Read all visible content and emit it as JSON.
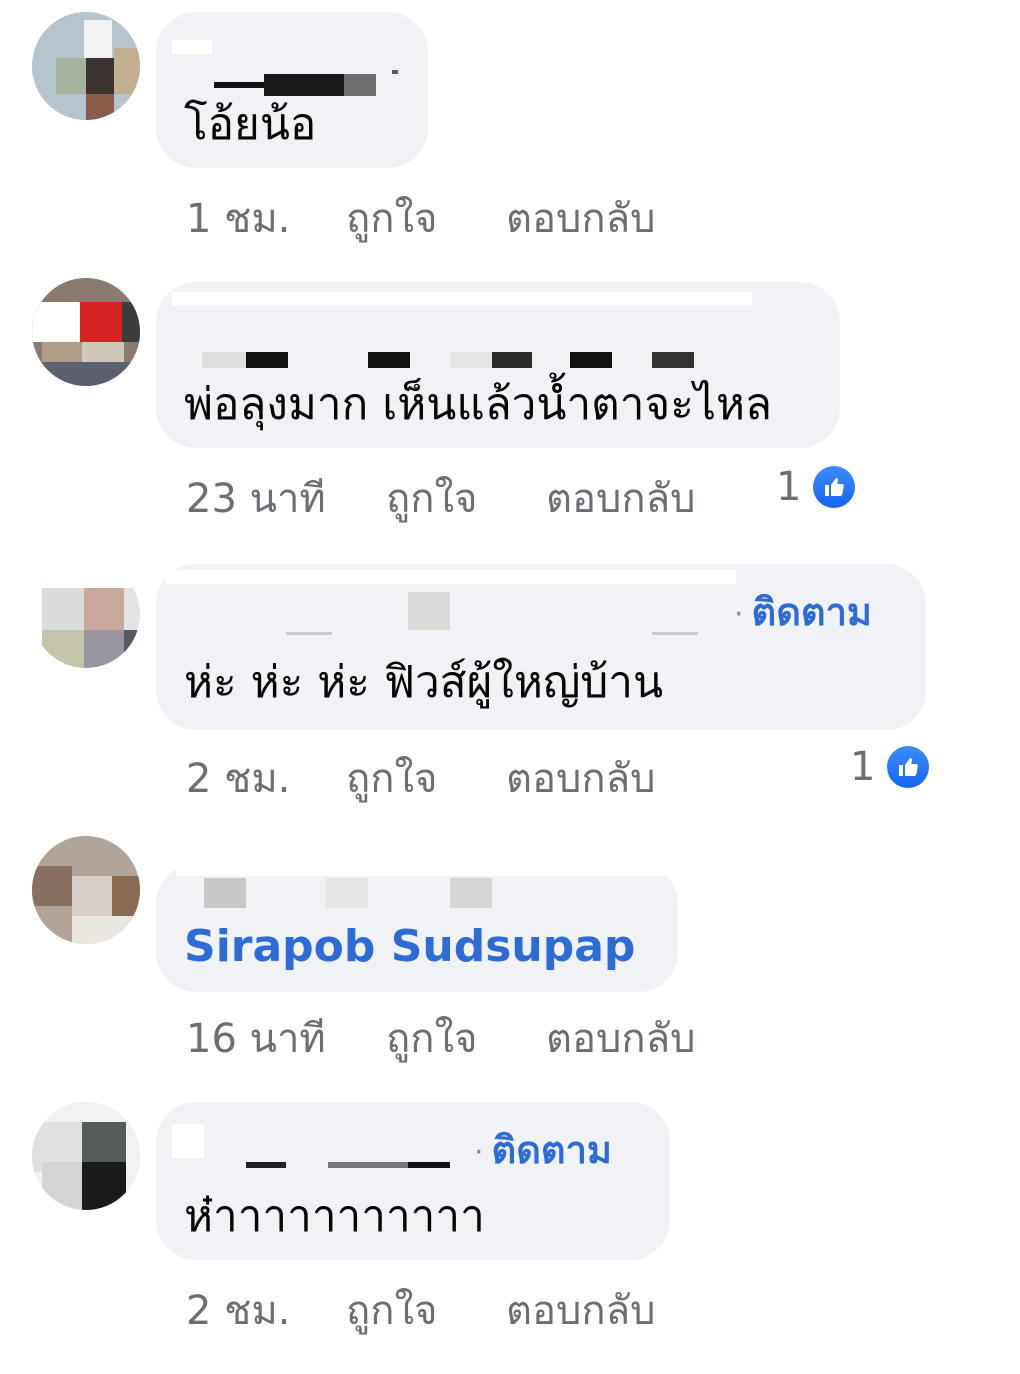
{
  "colors": {
    "bubble": "#f0f2f5",
    "link": "#2d6cd7",
    "meta_text": "#6b6e72",
    "like_badge": "#1877f2"
  },
  "comments": [
    {
      "text": "โอ้ยน้อ",
      "time": "1 ชม.",
      "like_label": "ถูกใจ",
      "reply_label": "ตอบกลับ"
    },
    {
      "text": "พ่อลุงมาก เห็นแล้วน้ำตาจะไหล",
      "time": "23 นาที",
      "like_label": "ถูกใจ",
      "reply_label": "ตอบกลับ",
      "reaction_count": "1",
      "reaction_icon": "like-icon"
    },
    {
      "text": "ห่ะ ห่ะ ห่ะ ฟิวส์ผู้ใหญ่บ้าน",
      "follow_label": "ติดตาม",
      "time": "2 ชม.",
      "like_label": "ถูกใจ",
      "reply_label": "ตอบกลับ",
      "reaction_count": "1",
      "reaction_icon": "like-icon"
    },
    {
      "tagged_name": "Sirapob Sudsupap",
      "time": "16 นาที",
      "like_label": "ถูกใจ",
      "reply_label": "ตอบกลับ"
    },
    {
      "text": "ห๋าาาาาาาาาาา",
      "follow_label": "ติดตาม",
      "time": "2 ชม.",
      "like_label": "ถูกใจ",
      "reply_label": "ตอบกลับ"
    }
  ]
}
